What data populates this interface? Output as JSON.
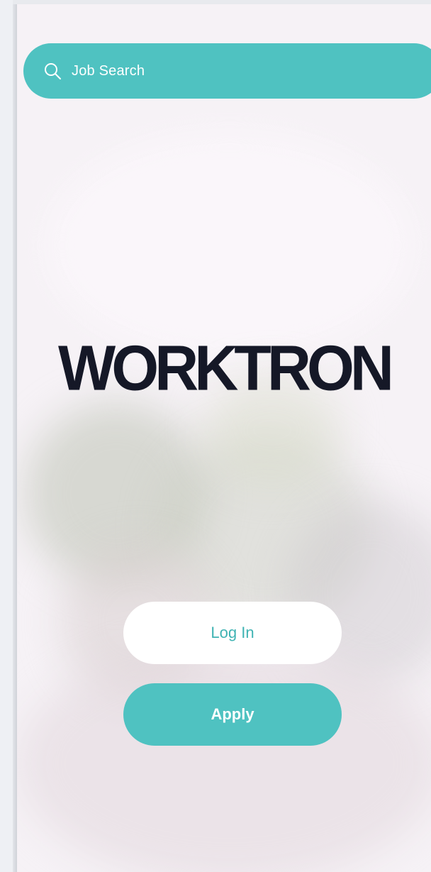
{
  "search": {
    "label": "Job Search",
    "icon": "search-icon"
  },
  "brand": {
    "logo_text": "WORKTRON"
  },
  "actions": {
    "login_label": "Log In",
    "apply_label": "Apply"
  },
  "colors": {
    "accent": "#4fc2c1",
    "logo": "#151827",
    "login_text": "#3fb3b3"
  }
}
